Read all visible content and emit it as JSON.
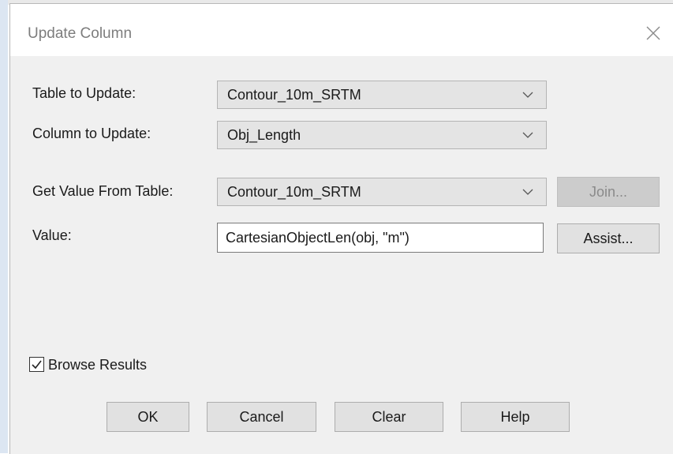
{
  "window": {
    "title": "Update Column"
  },
  "form": {
    "table_to_update": {
      "label": "Table to Update:",
      "value": "Contour_10m_SRTM"
    },
    "column_to_update": {
      "label": "Column to Update:",
      "value": "Obj_Length"
    },
    "get_value_from_table": {
      "label": "Get Value From Table:",
      "value": "Contour_10m_SRTM"
    },
    "value": {
      "label": "Value:",
      "text": "CartesianObjectLen(obj, \"m\")"
    }
  },
  "side_buttons": {
    "join_label": "Join...",
    "assist_label": "Assist..."
  },
  "options": {
    "browse_results": {
      "label": "Browse Results",
      "checked": true
    }
  },
  "footer": {
    "ok_label": "OK",
    "cancel_label": "Cancel",
    "clear_label": "Clear",
    "help_label": "Help"
  },
  "icons": {
    "close": "close-icon",
    "dropdown": "chevron-down-icon",
    "check": "checkmark-icon"
  },
  "colors": {
    "dialog_bg": "#f0f0f0",
    "title_bar_bg": "#ffffff",
    "combo_bg": "#e4e4e4",
    "disabled_button_bg": "#cccccc"
  }
}
